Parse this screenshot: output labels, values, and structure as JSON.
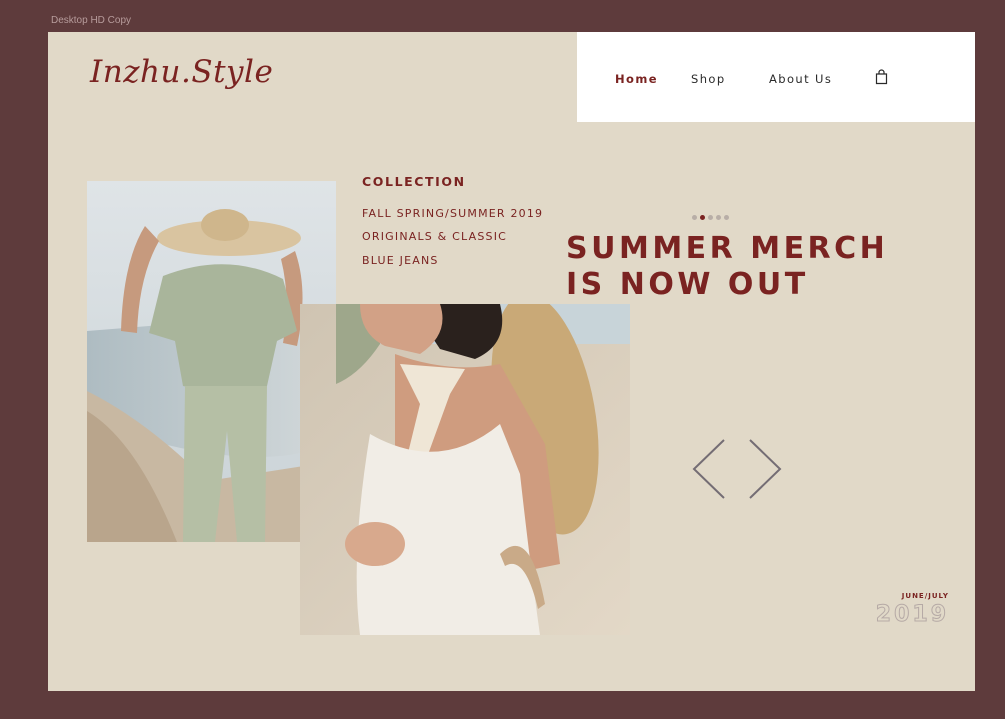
{
  "frame_label": "Desktop HD Copy",
  "brand": {
    "logo": "Inzhu.Style"
  },
  "nav": {
    "items": [
      {
        "label": "Home",
        "active": true
      },
      {
        "label": "Shop",
        "active": false
      },
      {
        "label": "About Us",
        "active": false
      }
    ],
    "cart_icon": "shopping-bag-icon"
  },
  "collection": {
    "heading": "COLLECTION",
    "links": [
      "FALL SPRING/SUMMER 2019",
      "ORIGINALS & CLASSIC",
      "BLUE JEANS"
    ]
  },
  "hero": {
    "headline_line1": "SUMMER MERCH",
    "headline_line2": "IS NOW OUT",
    "slider": {
      "count": 5,
      "active_index": 1
    },
    "prev_icon": "chevron-left-icon",
    "next_icon": "chevron-right-icon"
  },
  "season": {
    "label": "JUNE/JULY",
    "year": "2019"
  },
  "colors": {
    "brand": "#7a2321",
    "background": "#e1d9c8",
    "frame": "#5e3b3c",
    "nav_bg": "#ffffff"
  }
}
